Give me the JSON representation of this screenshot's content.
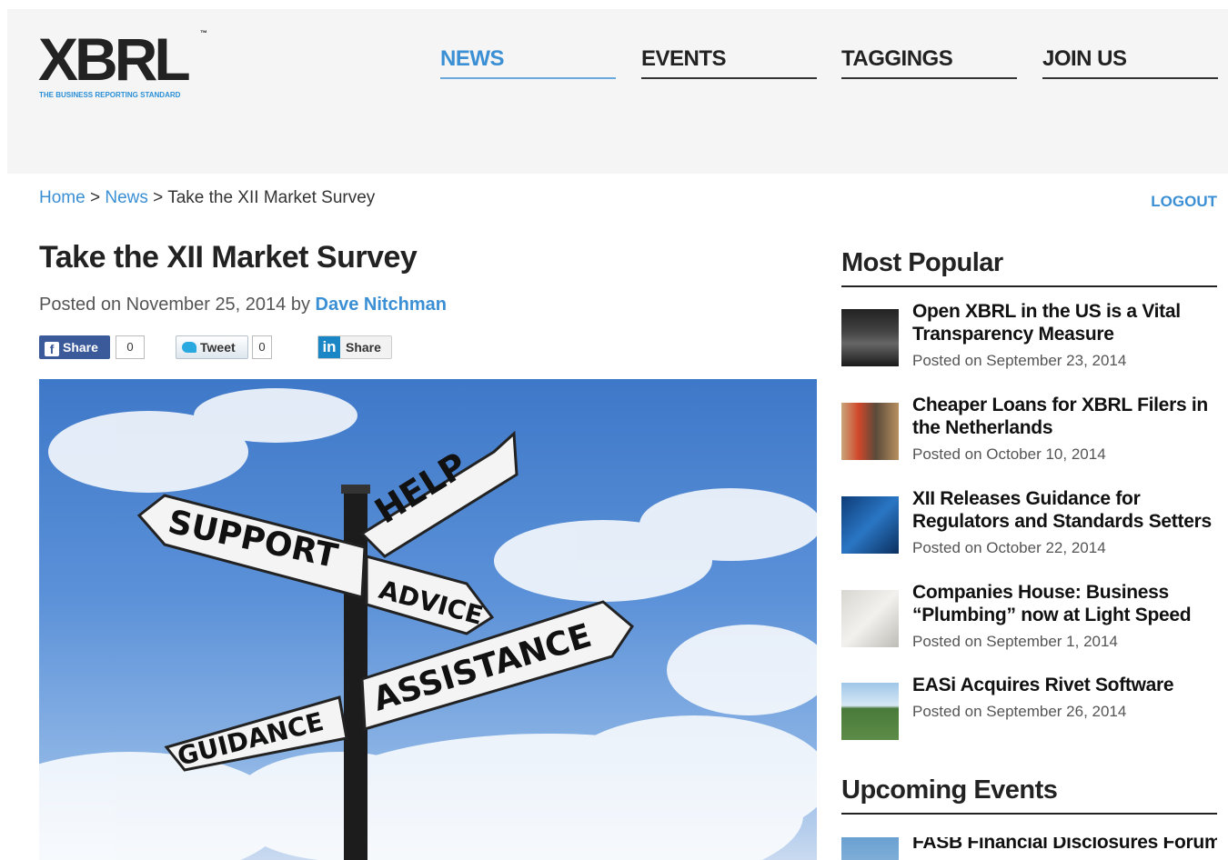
{
  "logo": {
    "text_main": "XBRL",
    "tm": "™",
    "tagline": "THE BUSINESS REPORTING STANDARD"
  },
  "nav": [
    {
      "label": "NEWS",
      "active": true
    },
    {
      "label": "EVENTS",
      "active": false
    },
    {
      "label": "TAGGINGS",
      "active": false
    },
    {
      "label": "JOIN US",
      "active": false
    }
  ],
  "breadcrumb": {
    "home": "Home",
    "sep1": ">",
    "news": "News",
    "sep2": ">",
    "current": "Take the XII Market Survey"
  },
  "logout": "LOGOUT",
  "post": {
    "title": "Take the XII Market Survey",
    "posted_prefix": "Posted on November 25, 2014 by",
    "author": "Dave Nitchman"
  },
  "share": {
    "facebook_label": "Share",
    "facebook_count": "0",
    "tweet_label": "Tweet",
    "tweet_count": "0",
    "linkedin_label": "Share"
  },
  "hero_signs": [
    "HELP",
    "SUPPORT",
    "ADVICE",
    "ASSISTANCE",
    "GUIDANCE"
  ],
  "most_popular": {
    "heading": "Most Popular",
    "items": [
      {
        "title": "Open XBRL in the US is a Vital Transparency Measure",
        "date": "Posted on September 23, 2014"
      },
      {
        "title": "Cheaper Loans for XBRL Filers in the Netherlands",
        "date": "Posted on October 10, 2014"
      },
      {
        "title": "XII Releases Guidance for Regulators and Standards Setters",
        "date": "Posted on October 22, 2014"
      },
      {
        "title": "Companies House: Business “Plumbing” now at Light Speed",
        "date": "Posted on September 1, 2014"
      },
      {
        "title": "EASi Acquires Rivet Software",
        "date": "Posted on September 26, 2014"
      }
    ]
  },
  "upcoming_events": {
    "heading": "Upcoming Events",
    "items": [
      {
        "title": "FASB Financial Disclosures Forum"
      }
    ]
  },
  "colors": {
    "accent": "#3b8fd4",
    "header_bg": "#f5f5f5",
    "facebook": "#3b5a9a"
  }
}
